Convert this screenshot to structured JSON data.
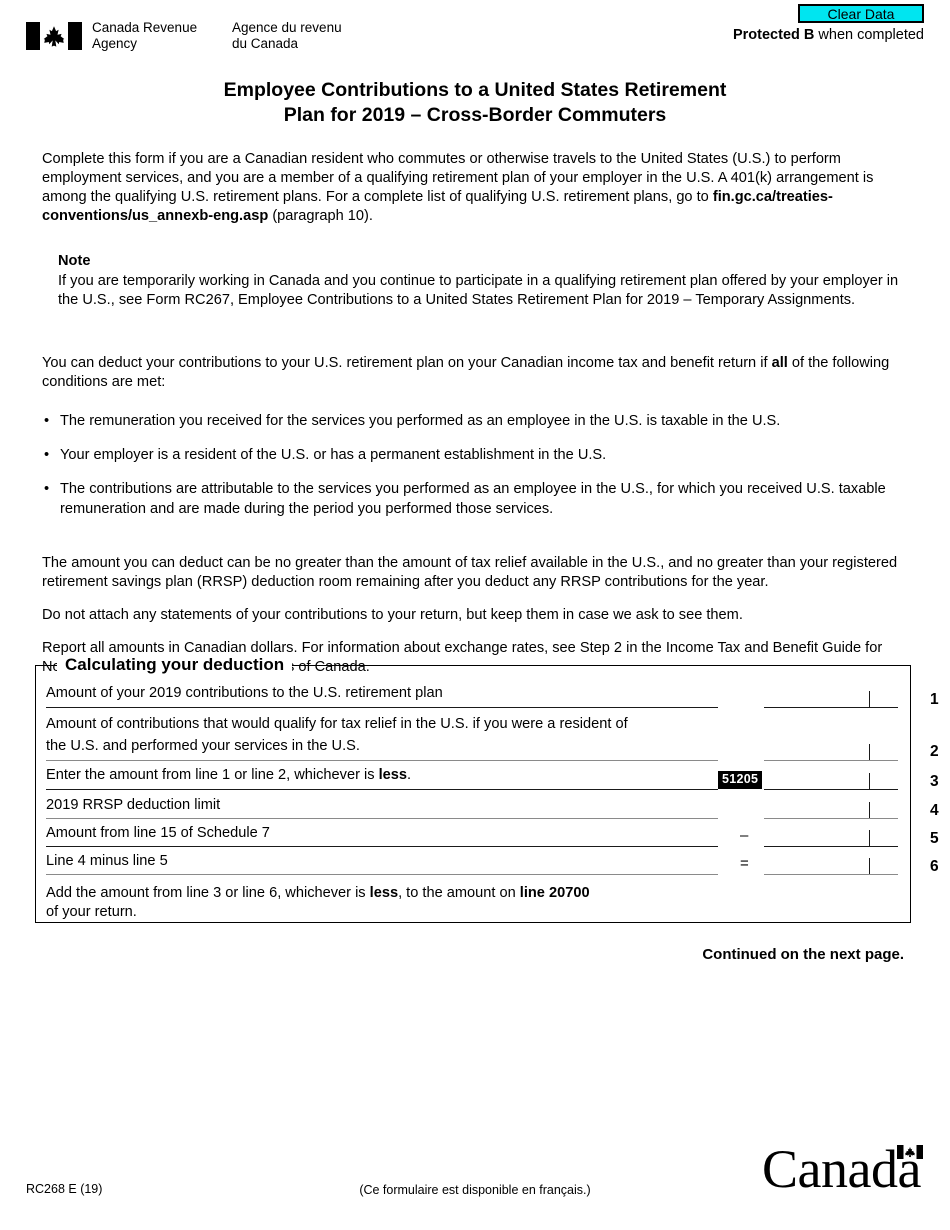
{
  "header": {
    "clear_button_label": "Clear Data",
    "clear_button_color": "#00e5f0",
    "protected_bold": "Protected B",
    "protected_rest": " when completed",
    "agency_en_line1": "Canada Revenue",
    "agency_en_line2": "Agency",
    "agency_fr_line1": "Agence du revenu",
    "agency_fr_line2": "du Canada",
    "logo_icon": "canada-flag-icon"
  },
  "title": {
    "line1": "Employee Contributions to a United States Retirement",
    "line2": "Plan for 2019 – Cross-Border Commuters"
  },
  "intro": {
    "p1_a": "Complete this form if you are a Canadian resident who commutes or otherwise travels to the United States (U.S.) to perform employment services, and you are a member of a qualifying retirement plan of your employer in the U.S. A 401(k) arrangement is among the qualifying U.S. retirement plans. For a complete list of qualifying U.S. retirement plans, go to ",
    "p1_link": "fin.gc.ca/treaties-conventions/us_annexb-eng.asp",
    "p1_b": " (paragraph 10)."
  },
  "note": {
    "heading": "Note",
    "text": "If you are temporarily working in Canada and you continue to participate in a qualifying retirement plan offered by your employer in the U.S., see Form RC267, Employee Contributions to a United States Retirement Plan for 2019 – Temporary Assignments."
  },
  "conditions": {
    "lead_a": "You can deduct your contributions to your U.S. retirement plan on your Canadian income tax and benefit return if ",
    "lead_bold": "all",
    "lead_b": " of the following conditions are met:",
    "bullet_char": "•",
    "items": [
      "The remuneration you received for the services you performed as an employee in the U.S. is taxable in the U.S.",
      "Your employer is a resident of the U.S. or has a permanent establishment in the U.S.",
      "The contributions are attributable to the services you performed as an employee in the U.S., for which you received U.S. taxable remuneration and are made during the period you performed those services."
    ]
  },
  "paragraphs": {
    "p_limit": "The amount you can deduct can be no greater than the amount of tax relief available in the U.S., and no greater than your registered retirement savings plan (RRSP) deduction room remaining after you deduct any RRSP contributions for the year.",
    "p_attach": "Do not attach any statements of your contributions to your return, but keep them in case we ask to see them.",
    "p_report": "Report all amounts in Canadian dollars. For information about exchange rates, see Step 2 in the Income Tax and Benefit Guide for Non Residents and Deemed Residents of Canada."
  },
  "calc": {
    "legend": "Calculating your deduction",
    "rows": [
      {
        "label": "Amount of your 2019 contributions to the U.S. retirement plan",
        "label2": "",
        "number": "1",
        "sign": "",
        "code": "",
        "value": "",
        "weight": "dark"
      },
      {
        "label": "Amount of contributions that would qualify for tax relief in the U.S. if you were a resident of",
        "label2": "the U.S. and performed your services in the U.S.",
        "number": "2",
        "sign": "",
        "code": "",
        "value": "",
        "weight": "light"
      },
      {
        "label_a": "Enter the amount from line 1 or line 2, whichever is ",
        "label_bold": "less",
        "label_b": ".",
        "label": "Enter the amount from line 1 or line 2, whichever is less.",
        "label2": "",
        "number": "3",
        "sign": "",
        "code": "51205",
        "value": "",
        "weight": "dark"
      },
      {
        "label": "2019 RRSP deduction limit",
        "label2": "",
        "number": "4",
        "sign": "",
        "code": "",
        "value": "",
        "weight": "light"
      },
      {
        "label": "Amount from line 15 of Schedule 7",
        "label2": "",
        "number": "5",
        "sign": "–",
        "code": "",
        "value": "",
        "weight": "dark"
      },
      {
        "label": "Line 4 minus line 5",
        "label2": "",
        "number": "6",
        "sign": "=",
        "code": "",
        "value": "",
        "weight": "light"
      }
    ],
    "closing_a": "Add the amount from line 3 or line 6, whichever is ",
    "closing_bold1": "less",
    "closing_b": ", to the amount on ",
    "closing_bold2": "line 20700",
    "closing_c": "",
    "closing_line2": "of your return."
  },
  "continued": "Continued on the next page.",
  "footer": {
    "form_code": "RC268 E (19)",
    "french_note": "(Ce formulaire est disponible en français.)",
    "wordmark": "Canada",
    "wordmark_flag_icon": "canada-flag-icon"
  }
}
